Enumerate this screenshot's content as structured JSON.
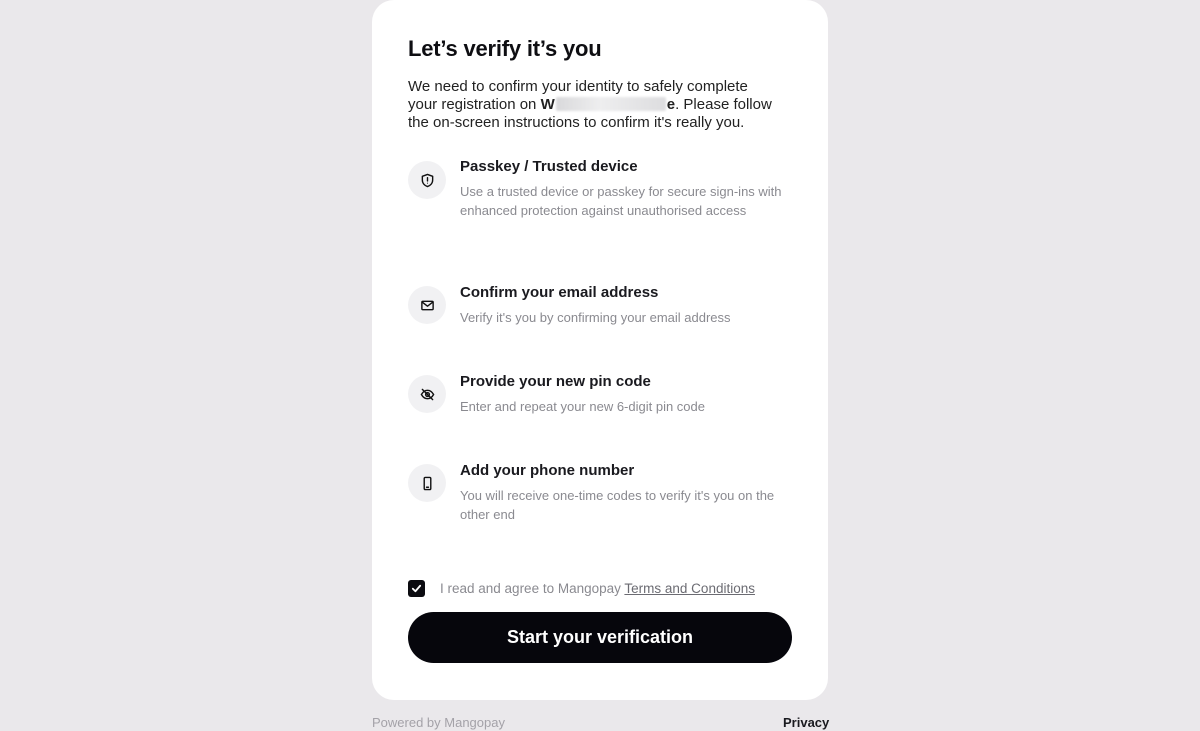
{
  "card": {
    "title": "Let’s verify it’s you",
    "intro_before": "We need to confirm your identity to safely complete your registration on ",
    "intro_brand_start": "W",
    "intro_brand_end": "e",
    "intro_after": ". Please follow the on-screen instructions to confirm it's really you."
  },
  "steps": [
    {
      "icon": "shield-icon",
      "title": "Passkey / Trusted device",
      "description": "Use a trusted device or passkey for secure sign-ins with enhanced protection against unauthorised access"
    },
    {
      "icon": "mail-icon",
      "title": "Confirm your email address",
      "description": "Verify it's you by confirming your email address"
    },
    {
      "icon": "eye-off-icon",
      "title": "Provide your new pin code",
      "description": "Enter and repeat your new 6-digit pin code"
    },
    {
      "icon": "phone-icon",
      "title": "Add your phone number",
      "description": "You will receive one-time codes to verify it's you on the other end"
    }
  ],
  "agreement": {
    "checked": true,
    "text": "I read and agree to Mangopay",
    "link": "Terms and Conditions"
  },
  "start_button": {
    "label": "Start your verification"
  },
  "footer": {
    "powered_by": "Powered by Mangopay",
    "privacy": "Privacy"
  },
  "colors": {
    "page_background": "#eae8eb",
    "card_background": "#ffffff",
    "primary_button": "#06060c",
    "muted_text": "#8a8a90"
  }
}
